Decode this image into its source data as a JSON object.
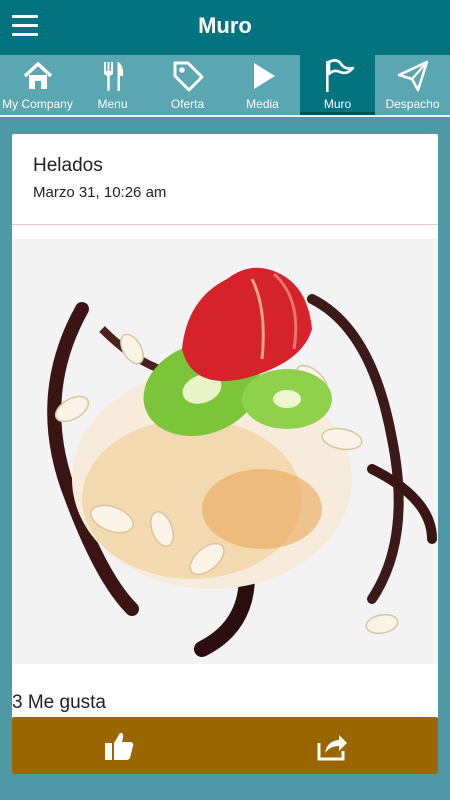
{
  "header": {
    "title": "Muro"
  },
  "tabs": [
    {
      "label": "My Company",
      "icon": "home-icon"
    },
    {
      "label": "Menu",
      "icon": "fork-knife-icon"
    },
    {
      "label": "Oferta",
      "icon": "tag-icon"
    },
    {
      "label": "Media",
      "icon": "play-icon"
    },
    {
      "label": "Muro",
      "icon": "flag-icon",
      "active": true
    },
    {
      "label": "Despacho",
      "icon": "paper-plane-icon"
    }
  ],
  "post": {
    "title": "Helados",
    "date": "Marzo 31, 10:26 am",
    "likes_text": "3 Me gusta"
  },
  "colors": {
    "topbar": "#03747f",
    "tabbar": "#5aa6b1",
    "background": "#4f98a5",
    "action_bar": "#9a6600"
  }
}
